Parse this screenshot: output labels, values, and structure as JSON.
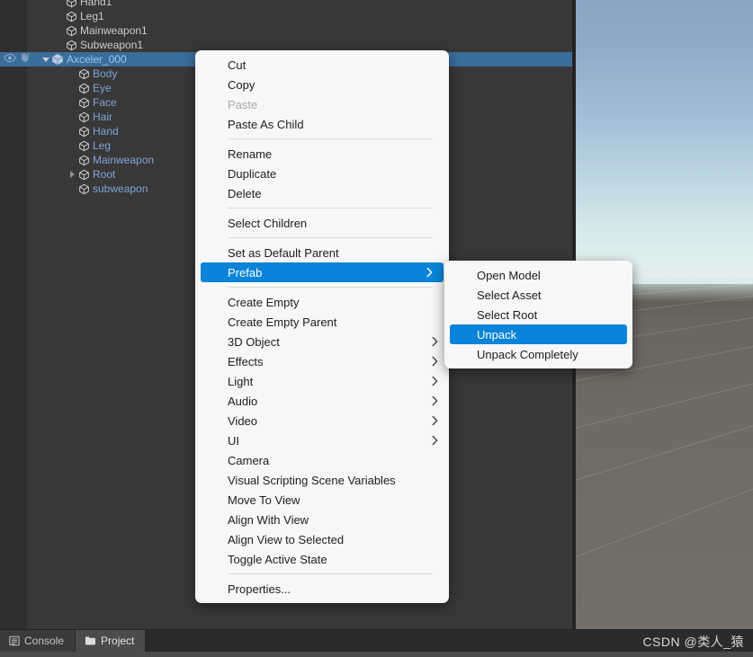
{
  "hierarchy": {
    "rows": [
      {
        "label": "Hand1",
        "indent": 60,
        "style": "normal",
        "twisty": "none",
        "selected": false
      },
      {
        "label": "Leg1",
        "indent": 60,
        "style": "normal",
        "twisty": "none",
        "selected": false
      },
      {
        "label": "Mainweapon1",
        "indent": 60,
        "style": "normal",
        "twisty": "none",
        "selected": false
      },
      {
        "label": "Subweapon1",
        "indent": 60,
        "style": "normal",
        "twisty": "none",
        "selected": false
      },
      {
        "label": "Axceler_000",
        "indent": 44,
        "style": "prefab-root",
        "twisty": "down",
        "selected": true
      },
      {
        "label": "Body",
        "indent": 74,
        "style": "prefab",
        "twisty": "none",
        "selected": false
      },
      {
        "label": "Eye",
        "indent": 74,
        "style": "prefab",
        "twisty": "none",
        "selected": false
      },
      {
        "label": "Face",
        "indent": 74,
        "style": "prefab",
        "twisty": "none",
        "selected": false
      },
      {
        "label": "Hair",
        "indent": 74,
        "style": "prefab",
        "twisty": "none",
        "selected": false
      },
      {
        "label": "Hand",
        "indent": 74,
        "style": "prefab",
        "twisty": "none",
        "selected": false
      },
      {
        "label": "Leg",
        "indent": 74,
        "style": "prefab",
        "twisty": "none",
        "selected": false
      },
      {
        "label": "Mainweapon",
        "indent": 74,
        "style": "prefab",
        "twisty": "none",
        "selected": false
      },
      {
        "label": "Root",
        "indent": 74,
        "style": "prefab",
        "twisty": "right",
        "selected": false
      },
      {
        "label": "subweapon",
        "indent": 74,
        "style": "prefab",
        "twisty": "none",
        "selected": false
      }
    ],
    "selected_row_icons": [
      "eye-icon",
      "hand-icon"
    ]
  },
  "context_menu": {
    "items": [
      {
        "label": "Cut",
        "type": "item"
      },
      {
        "label": "Copy",
        "type": "item"
      },
      {
        "label": "Paste",
        "type": "disabled"
      },
      {
        "label": "Paste As Child",
        "type": "item"
      },
      {
        "type": "separator"
      },
      {
        "label": "Rename",
        "type": "item"
      },
      {
        "label": "Duplicate",
        "type": "item"
      },
      {
        "label": "Delete",
        "type": "item"
      },
      {
        "type": "separator"
      },
      {
        "label": "Select Children",
        "type": "item"
      },
      {
        "type": "separator"
      },
      {
        "label": "Set as Default Parent",
        "type": "item"
      },
      {
        "label": "Prefab",
        "type": "submenu-highlighted"
      },
      {
        "type": "separator"
      },
      {
        "label": "Create Empty",
        "type": "item"
      },
      {
        "label": "Create Empty Parent",
        "type": "item"
      },
      {
        "label": "3D Object",
        "type": "submenu"
      },
      {
        "label": "Effects",
        "type": "submenu"
      },
      {
        "label": "Light",
        "type": "submenu"
      },
      {
        "label": "Audio",
        "type": "submenu"
      },
      {
        "label": "Video",
        "type": "submenu"
      },
      {
        "label": "UI",
        "type": "submenu"
      },
      {
        "label": "Camera",
        "type": "item"
      },
      {
        "label": "Visual Scripting Scene Variables",
        "type": "item"
      },
      {
        "label": "Move To View",
        "type": "item"
      },
      {
        "label": "Align With View",
        "type": "item"
      },
      {
        "label": "Align View to Selected",
        "type": "item"
      },
      {
        "label": "Toggle Active State",
        "type": "item"
      },
      {
        "type": "separator"
      },
      {
        "label": "Properties...",
        "type": "item"
      }
    ]
  },
  "prefab_submenu": {
    "items": [
      {
        "label": "Open Model",
        "type": "item"
      },
      {
        "label": "Select Asset",
        "type": "item"
      },
      {
        "label": "Select Root",
        "type": "item"
      },
      {
        "label": "Unpack",
        "type": "highlighted"
      },
      {
        "label": "Unpack Completely",
        "type": "item"
      }
    ]
  },
  "bottom_bar": {
    "tabs": [
      {
        "label": "Console",
        "icon": "console-icon",
        "active": false
      },
      {
        "label": "Project",
        "icon": "folder-icon",
        "active": true
      }
    ],
    "watermark": "CSDN @类人_猿"
  },
  "colors": {
    "selection_blue": "#3a6d9a",
    "menu_highlight": "#0a84d8",
    "panel_bg": "#383838",
    "menu_bg": "#f7f7f7"
  }
}
